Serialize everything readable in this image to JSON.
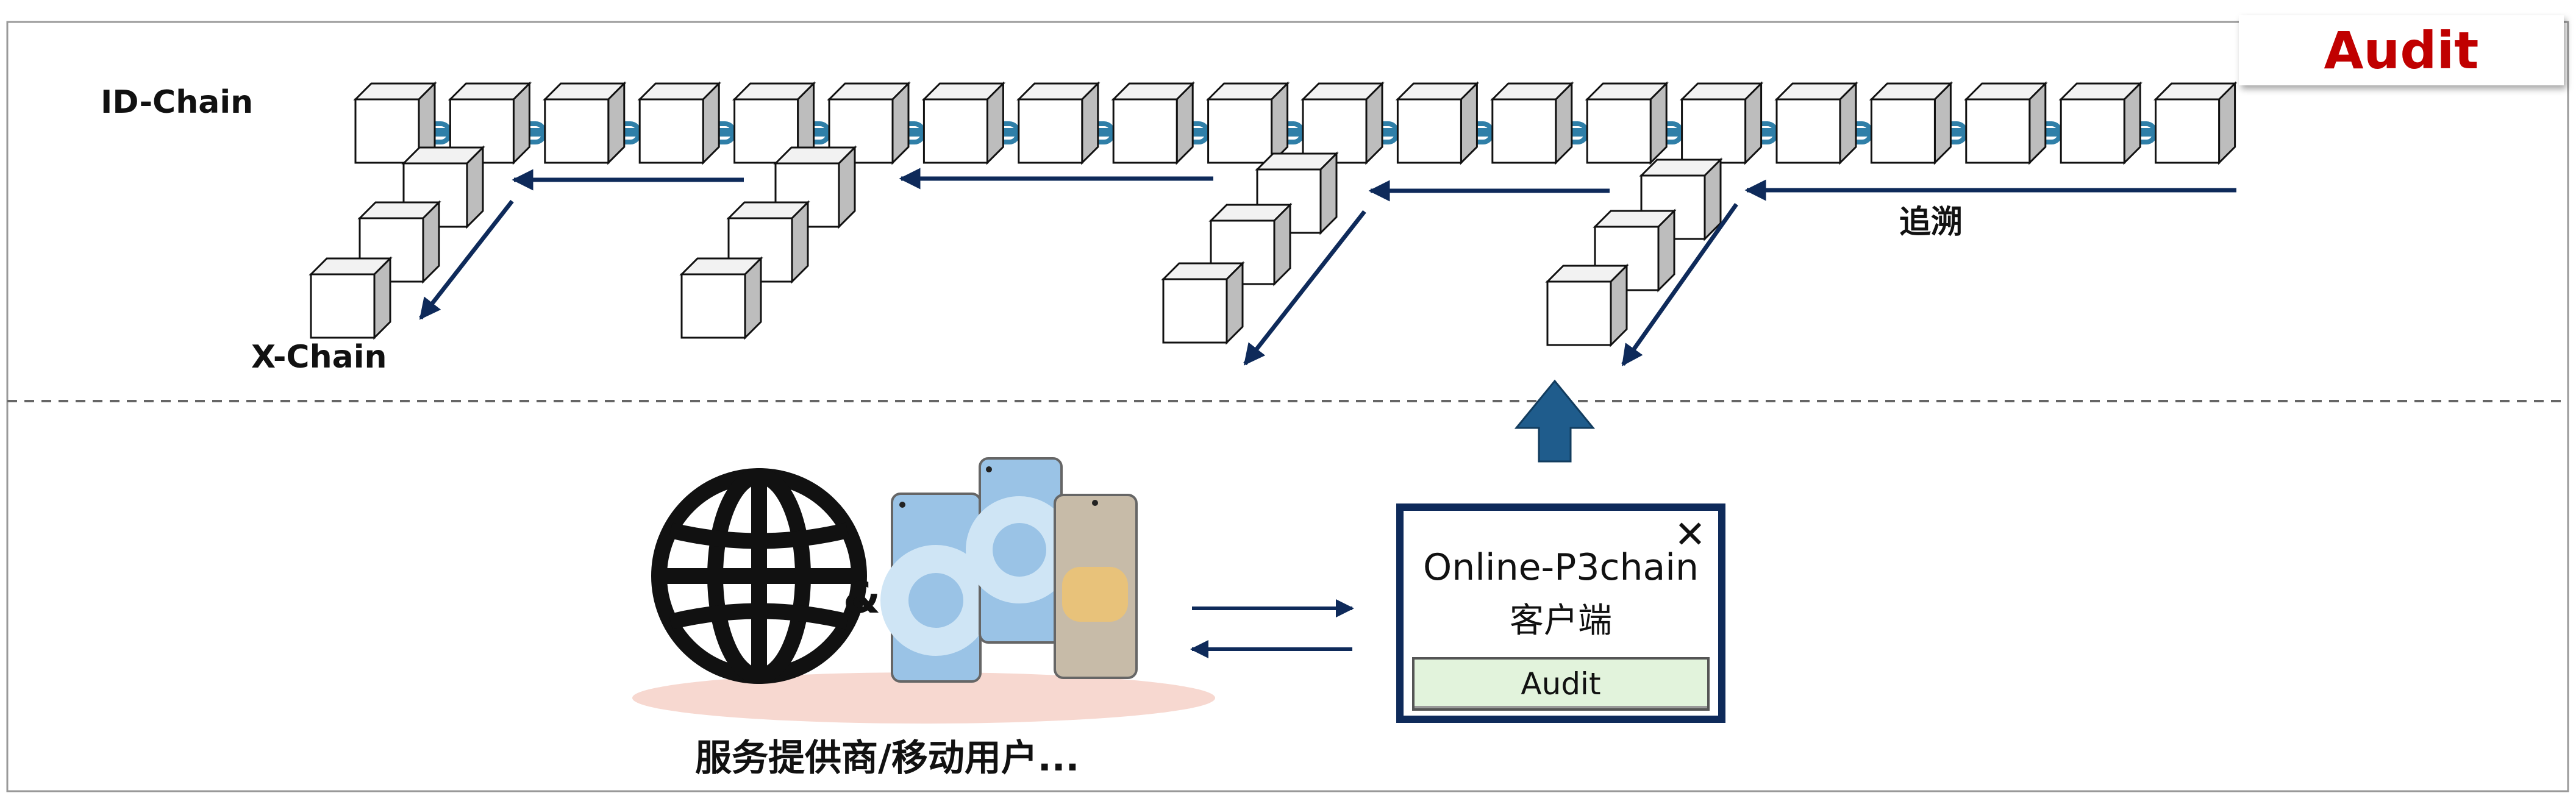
{
  "labels": {
    "id_chain": "ID-Chain",
    "x_chain": "X-Chain",
    "trace": "追溯",
    "audit_badge": "Audit",
    "caption": "服务提供商/移动用户..."
  },
  "client": {
    "title": "Online-P3chain",
    "subtitle": "客户端",
    "close_glyph": "✕",
    "button_label": "Audit"
  },
  "connector": "&",
  "icons": [
    "globe-icon",
    "smartphone-icon",
    "upload-arrow-icon",
    "close-icon"
  ],
  "colors": {
    "navy": "#0e2a5a",
    "upload_arrow": "#1f5c8c",
    "audit_red": "#c00000",
    "id_link": "#2f7fa8",
    "branch_orange": "#f07a2b",
    "branch_green": "#3a8a2a",
    "branch_purple": "#7a3fb0",
    "branch_cyan": "#2aaee8",
    "button_green": "#e2f3dc",
    "platform_pink": "#f7d8d0"
  }
}
